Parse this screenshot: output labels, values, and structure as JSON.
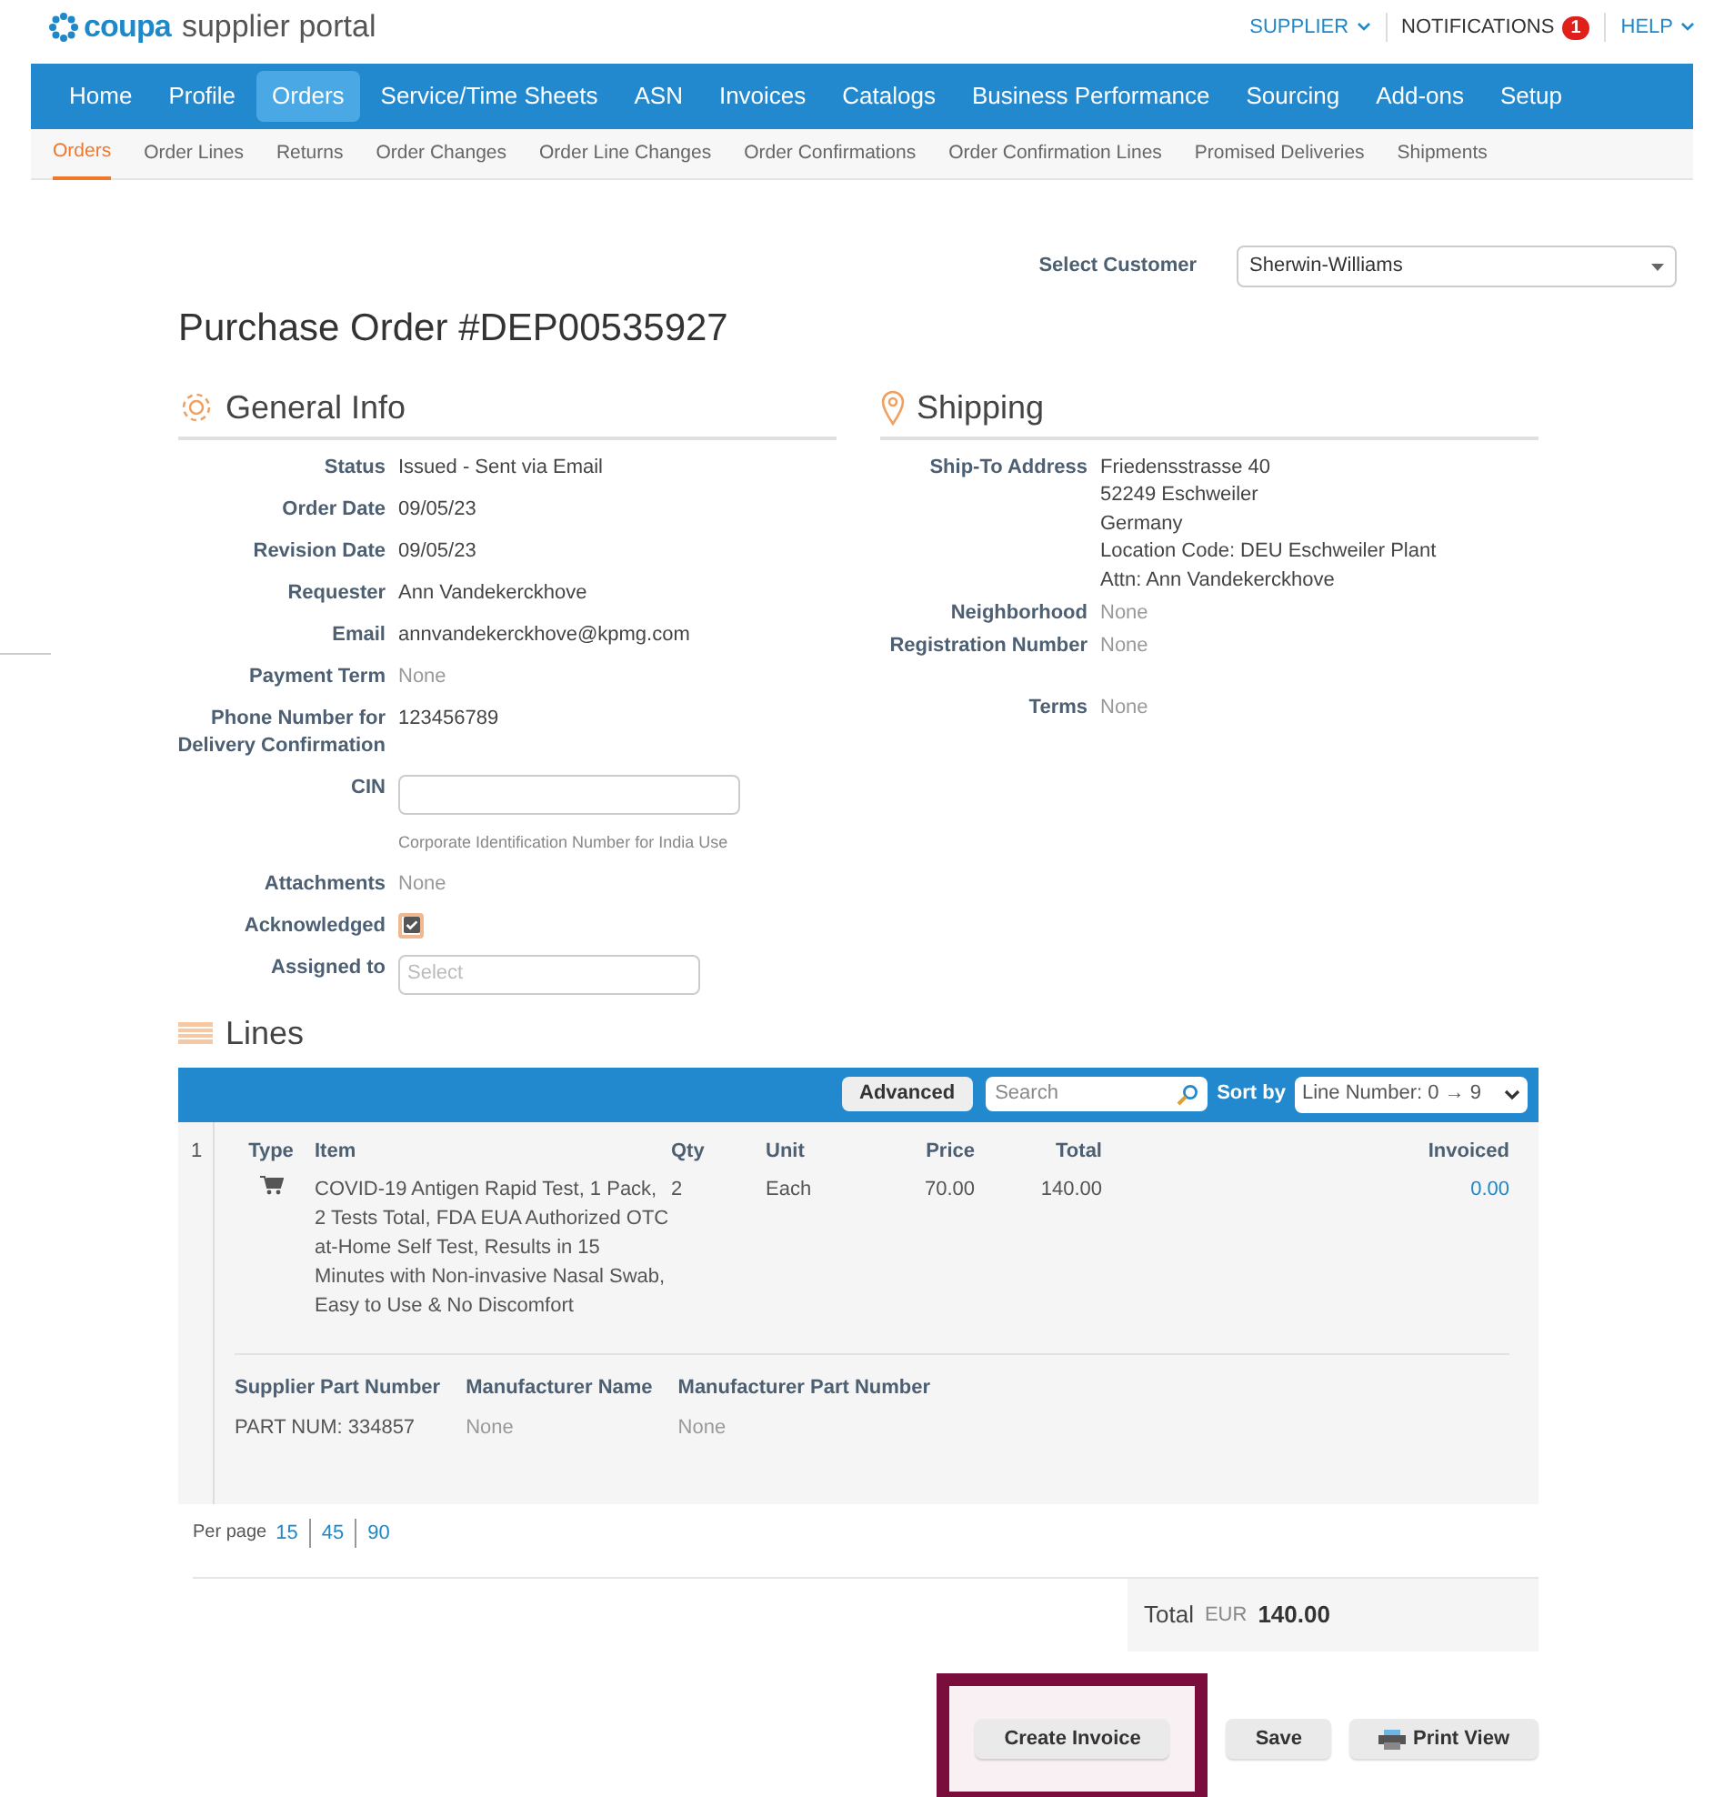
{
  "header": {
    "logo_brand": "coupa",
    "logo_text": "supplier portal",
    "links": [
      {
        "label": "SUPPLIER",
        "kind": "dropdown"
      },
      {
        "label": "NOTIFICATIONS",
        "kind": "badge",
        "badge": "1"
      },
      {
        "label": "HELP",
        "kind": "dropdown"
      }
    ]
  },
  "nav": [
    {
      "label": "Home",
      "selected": false
    },
    {
      "label": "Profile",
      "selected": false
    },
    {
      "label": "Orders",
      "selected": true
    },
    {
      "label": "Service/Time Sheets",
      "selected": false
    },
    {
      "label": "ASN",
      "selected": false
    },
    {
      "label": "Invoices",
      "selected": false
    },
    {
      "label": "Catalogs",
      "selected": false
    },
    {
      "label": "Business Performance",
      "selected": false
    },
    {
      "label": "Sourcing",
      "selected": false
    },
    {
      "label": "Add-ons",
      "selected": false
    },
    {
      "label": "Setup",
      "selected": false
    }
  ],
  "subnav": [
    {
      "label": "Orders",
      "selected": true
    },
    {
      "label": "Order Lines",
      "selected": false
    },
    {
      "label": "Returns",
      "selected": false
    },
    {
      "label": "Order Changes",
      "selected": false
    },
    {
      "label": "Order Line Changes",
      "selected": false
    },
    {
      "label": "Order Confirmations",
      "selected": false
    },
    {
      "label": "Order Confirmation Lines",
      "selected": false
    },
    {
      "label": "Promised Deliveries",
      "selected": false
    },
    {
      "label": "Shipments",
      "selected": false
    }
  ],
  "select_customer": {
    "label": "Select Customer",
    "value": "Sherwin-Williams"
  },
  "title": "Purchase Order #DEP00535927",
  "general_info": {
    "title": "General Info",
    "fields": [
      {
        "label": "Status",
        "kind": "text",
        "value": "Issued - Sent via Email"
      },
      {
        "label": "Order Date",
        "kind": "text",
        "value": "09/05/23"
      },
      {
        "label": "Revision Date",
        "kind": "text",
        "value": "09/05/23"
      },
      {
        "label": "Requester",
        "kind": "text",
        "value": "Ann Vandekerckhove"
      },
      {
        "label": "Email",
        "kind": "text",
        "value": "annvandekerckhove@kpmg.com"
      },
      {
        "label": "Payment Term",
        "kind": "none",
        "value": "None"
      },
      {
        "label": "Phone Number for Delivery Confirmation",
        "kind": "text",
        "value": "123456789"
      },
      {
        "label": "CIN",
        "kind": "input",
        "hint": "Corporate Identification Number for India Use"
      },
      {
        "label": "Attachments",
        "kind": "none",
        "value": "None"
      },
      {
        "label": "Acknowledged",
        "kind": "checkbox",
        "checked": true
      },
      {
        "label": "Assigned to",
        "kind": "select",
        "placeholder": "Select"
      }
    ]
  },
  "shipping": {
    "title": "Shipping",
    "fields": [
      {
        "label": "Ship-To Address",
        "kind": "lines",
        "lines": [
          "Friedensstrasse 40",
          "52249 Eschweiler",
          "Germany",
          "Location Code: DEU Eschweiler Plant",
          "Attn: Ann Vandekerckhove"
        ]
      },
      {
        "label": "Neighborhood",
        "kind": "none",
        "value": "None"
      },
      {
        "label": "Registration Number",
        "kind": "none",
        "value": "None"
      },
      {
        "label": "Terms",
        "kind": "none",
        "value": "None"
      }
    ]
  },
  "lines": {
    "title": "Lines",
    "advanced": "Advanced",
    "search_placeholder": "Search",
    "sort_label": "Sort by",
    "sort_value": "Line Number: 0 → 9",
    "columns": [
      "Type",
      "Item",
      "Qty",
      "Unit",
      "Price",
      "Total",
      "Invoiced"
    ],
    "rows": [
      {
        "number": "1",
        "item": "COVID-19 Antigen Rapid Test, 1 Pack, 2 Tests Total, FDA EUA Authorized OTC at-Home Self Test, Results in 15 Minutes with Non-invasive Nasal Swab, Easy to Use & No Discomfort",
        "qty": "2",
        "unit": "Each",
        "price": "70.00",
        "total": "140.00",
        "invoiced": "0.00",
        "details": [
          {
            "label": "Supplier Part Number",
            "value": "PART NUM: 334857",
            "muted": false
          },
          {
            "label": "Manufacturer Name",
            "value": "None",
            "muted": true
          },
          {
            "label": "Manufacturer Part Number",
            "value": "None",
            "muted": true
          }
        ]
      }
    ],
    "per_page_label": "Per page",
    "per_page": [
      "15",
      "45",
      "90"
    ]
  },
  "total": {
    "label": "Total",
    "currency": "EUR",
    "amount": "140.00"
  },
  "buttons": [
    {
      "label": "Create Invoice",
      "highlighted": true,
      "kind": "plain"
    },
    {
      "label": "Save",
      "highlighted": false,
      "kind": "plain"
    },
    {
      "label": "Print View",
      "highlighted": false,
      "kind": "print"
    }
  ]
}
